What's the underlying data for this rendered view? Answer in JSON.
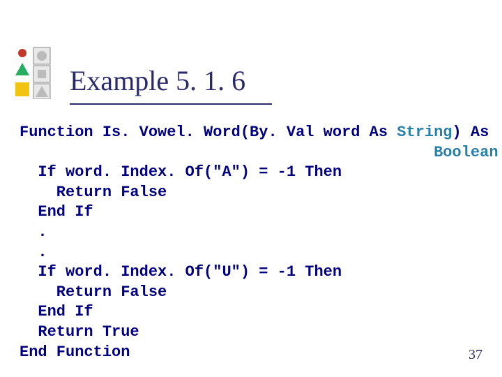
{
  "title": "Example 5. 1. 6",
  "page_number": "37",
  "code": {
    "l01a": "Function Is. Vowel. Word(By. Val word As ",
    "l01b": "String",
    "l01c": ") As",
    "l02a": "                                             ",
    "l02b": "Boolean",
    "l03": "  If word. Index. Of(\"A\") = -1 Then",
    "l04": "    Return False",
    "l05": "  End If",
    "l06": "  .",
    "l07": "  .",
    "l08": "  If word. Index. Of(\"U\") = -1 Then",
    "l09": "    Return False",
    "l10": "  End If",
    "l11": "  Return True",
    "l12": "End Function"
  }
}
